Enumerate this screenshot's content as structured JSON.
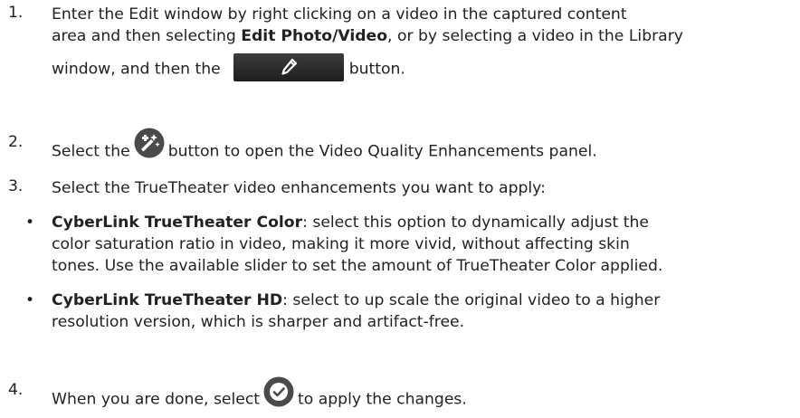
{
  "steps": {
    "s1": {
      "num": "1.",
      "line1": "Enter the Edit window by right clicking on a video in the captured content",
      "line2_pre": "area and then selecting ",
      "line2_bold": "Edit Photo/Video",
      "line2_post": ", or by selecting a video in the Library",
      "line3_pre": "window, and then the",
      "line3_post": "button."
    },
    "s2": {
      "num": "2.",
      "pre": "Select the",
      "post": "button to open the Video Quality Enhancements panel."
    },
    "s3": {
      "num": "3.",
      "text": "Select the TrueTheater video enhancements you want to apply:"
    },
    "s4": {
      "num": "4.",
      "pre": "When you are done, select",
      "post": "to apply the changes."
    }
  },
  "bullets": [
    {
      "bullet": "•",
      "bold": "CyberLink TrueTheater Color",
      "line1_post": ": select this option to dynamically adjust the",
      "line2": "color saturation ratio in video, making it more vivid, without affecting skin",
      "line3": "tones. Use the available slider to set the amount of TrueTheater Color applied."
    },
    {
      "bullet": "•",
      "bold": "CyberLink TrueTheater HD",
      "line1_post": ": select to up scale the original video to a higher",
      "line2": "resolution version, which is sharper and artifact-free."
    }
  ],
  "icons": {
    "edit_button": "pencil-icon",
    "enhance_button": "magic-wand-film-icon",
    "apply_button": "checkmark-icon"
  },
  "colors": {
    "text": "#222222",
    "button_dark": "#2a2a2a",
    "icon_grey": "#4a4a4a",
    "check_bg": "#ffffff"
  }
}
